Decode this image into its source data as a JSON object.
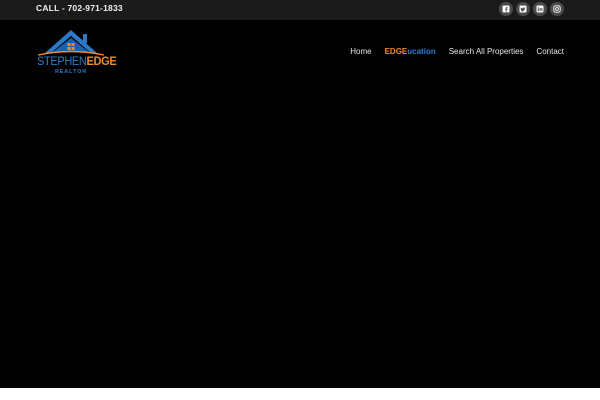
{
  "topbar": {
    "call_text": "CALL - 702-971-1833",
    "social_icons": [
      "facebook-icon",
      "twitter-icon",
      "linkedin-icon",
      "instagram-icon"
    ]
  },
  "logo": {
    "word1": "STEPHEN",
    "word2": "EDGE",
    "subtitle": "REALTOR",
    "colors": {
      "blue": "#2f79c4",
      "orange": "#f08a2a"
    }
  },
  "nav": {
    "home": "Home",
    "education_part1": "EDGE",
    "education_part2": "ucation",
    "search": "Search All Properties",
    "contact": "Contact"
  },
  "colors": {
    "topbar_bg": "#1b1b1b",
    "hero_bg": "#000000",
    "accent_orange": "#f08a2a",
    "accent_blue": "#2f7fd6"
  }
}
